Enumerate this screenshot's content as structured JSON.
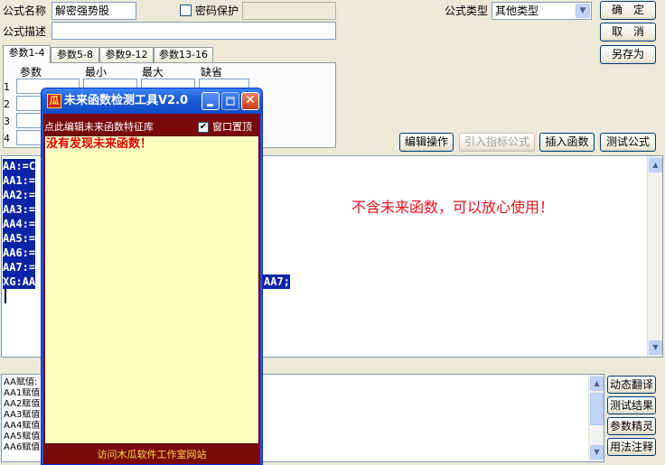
{
  "header": {
    "name_label": "公式名称",
    "name_value": "解密强势股",
    "password_label": "密码保护",
    "desc_label": "公式描述",
    "type_label": "公式类型",
    "type_value": "其他类型"
  },
  "buttons": {
    "confirm": "确　定",
    "cancel": "取　消",
    "save_as": "另存为",
    "edit_op": "编辑操作",
    "import_formula": "引入指标公式",
    "insert_func": "插入函数",
    "test_formula": "测试公式"
  },
  "param_tabs": [
    "参数1-4",
    "参数5-8",
    "参数9-12",
    "参数13-16"
  ],
  "param_headers": [
    "参数",
    "最小",
    "最大",
    "缺省"
  ],
  "param_rows": [
    "1",
    "2",
    "3",
    "4"
  ],
  "editor": {
    "lines": [
      "AA:=C",
      "AA1:=",
      "AA2:=",
      "AA3:=",
      "AA4:=",
      "AA5:=",
      "AA6:=",
      "AA7:=",
      "XG:AA"
    ],
    "line_tail": "AA7;",
    "annotation": "不含未来函数，可以放心使用！",
    "annotation_color": "#e8141e"
  },
  "log_lines": [
    "AA赋值:",
    "AA1赋值",
    "AA2赋值",
    "AA3赋值",
    "AA4赋值",
    "AA5赋值",
    "AA6赋值"
  ],
  "side_buttons": [
    "动态翻译",
    "测试结果",
    "参数精灵",
    "用法注释"
  ],
  "tool_window": {
    "title": "未来函数检测工具V2.0",
    "logo_char": "瓜",
    "edit_link": "点此编辑未来函数特征库",
    "on_top_label": "窗口置顶",
    "result": "没有发现未来函数！",
    "footer": "访问木瓜软件工作室网站",
    "colors": {
      "titlebar": "#2457c8",
      "panel": "#ffffc0",
      "dark": "#7a0a0a",
      "result": "#e00000"
    }
  }
}
